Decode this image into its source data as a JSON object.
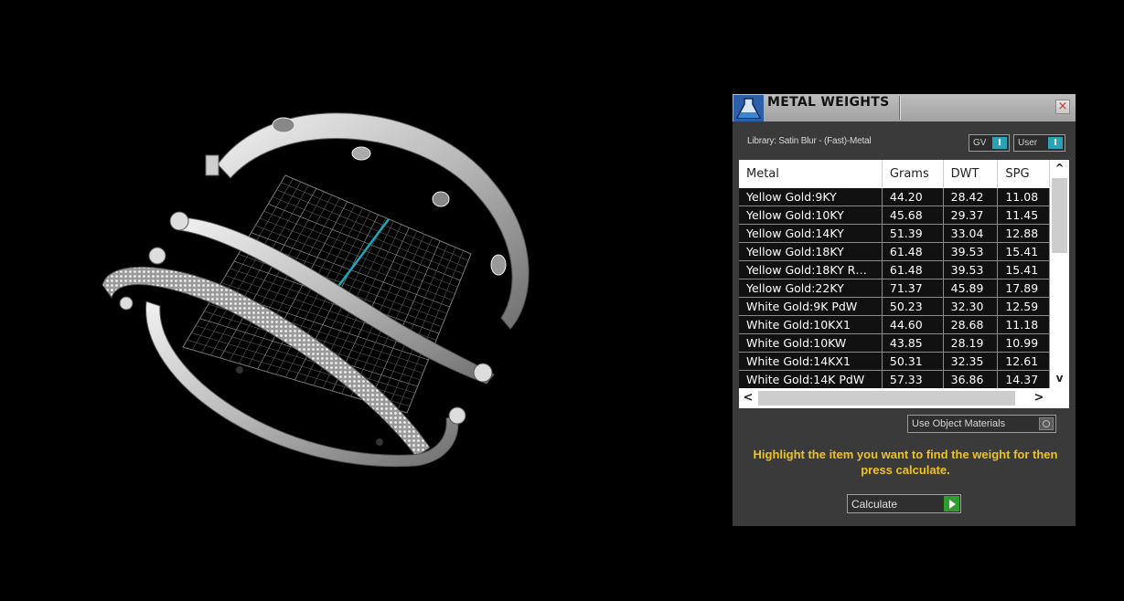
{
  "panel": {
    "title": "METAL WEIGHTS",
    "close_glyph": "×",
    "icon": "metal-flask-icon",
    "library_label": "Library: Satin Blur - (Fast)-Metal",
    "toggles": {
      "gv_label": "GV",
      "user_label": "User",
      "knob_glyph": "I"
    },
    "table": {
      "columns": [
        "Metal",
        "Grams",
        "DWT",
        "SPG"
      ],
      "rows": [
        {
          "metal": "Yellow Gold:9KY",
          "grams": "44.20",
          "dwt": "28.42",
          "spg": "11.08"
        },
        {
          "metal": "Yellow Gold:10KY",
          "grams": "45.68",
          "dwt": "29.37",
          "spg": "11.45"
        },
        {
          "metal": "Yellow Gold:14KY",
          "grams": "51.39",
          "dwt": "33.04",
          "spg": "12.88"
        },
        {
          "metal": "Yellow Gold:18KY",
          "grams": "61.48",
          "dwt": "39.53",
          "spg": "15.41"
        },
        {
          "metal": "Yellow Gold:18KY R…",
          "grams": "61.48",
          "dwt": "39.53",
          "spg": "15.41"
        },
        {
          "metal": "Yellow Gold:22KY",
          "grams": "71.37",
          "dwt": "45.89",
          "spg": "17.89"
        },
        {
          "metal": "White Gold:9K PdW",
          "grams": "50.23",
          "dwt": "32.30",
          "spg": "12.59"
        },
        {
          "metal": "White Gold:10KX1",
          "grams": "44.60",
          "dwt": "28.68",
          "spg": "11.18"
        },
        {
          "metal": "White Gold:10KW",
          "grams": "43.85",
          "dwt": "28.19",
          "spg": "10.99"
        },
        {
          "metal": "White Gold:14KX1",
          "grams": "50.31",
          "dwt": "32.35",
          "spg": "12.61"
        },
        {
          "metal": "White Gold:14K PdW",
          "grams": "57.33",
          "dwt": "36.86",
          "spg": "14.37"
        }
      ],
      "scroll": {
        "up": "^",
        "down": "v",
        "left": "<",
        "right": ">"
      }
    },
    "use_object_materials_label": "Use Object Materials",
    "hint": "Highlight the item you want to find the weight for then press calculate.",
    "calculate_label": "Calculate"
  }
}
